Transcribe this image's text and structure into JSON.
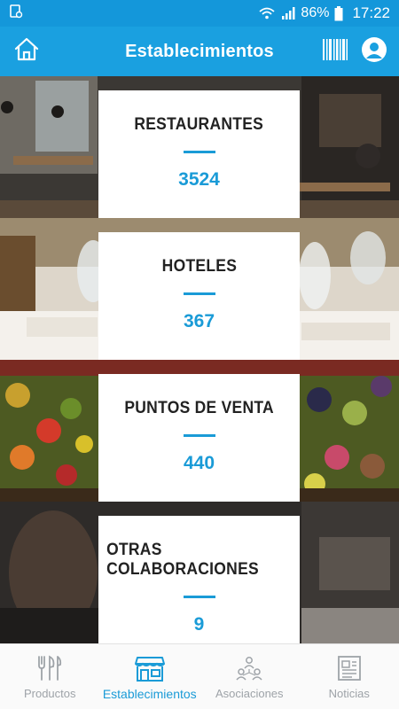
{
  "status_bar": {
    "battery": "86%",
    "time": "17:22",
    "icons": [
      "sim-card-icon",
      "wifi-icon",
      "signal-icon",
      "battery-icon"
    ]
  },
  "app_bar": {
    "title": "Establecimientos",
    "left_icon": "home-icon",
    "right_icons": [
      "barcode-icon",
      "user-icon"
    ]
  },
  "sections": [
    {
      "title": "RESTAURANTES",
      "count": "3524"
    },
    {
      "title": "HOTELES",
      "count": "367"
    },
    {
      "title": "PUNTOS DE VENTA",
      "count": "440"
    },
    {
      "title": "OTRAS COLABORACIONES",
      "count": "9"
    }
  ],
  "bottom_nav": {
    "items": [
      {
        "label": "Productos",
        "icon": "cutlery-icon",
        "active": false
      },
      {
        "label": "Establecimientos",
        "icon": "store-icon",
        "active": true
      },
      {
        "label": "Asociaciones",
        "icon": "people-network-icon",
        "active": false
      },
      {
        "label": "Noticias",
        "icon": "newspaper-icon",
        "active": false
      }
    ]
  },
  "colors": {
    "primary": "#1aa0e0",
    "accent": "#1a9bd7",
    "inactive": "#9ea3a8"
  }
}
